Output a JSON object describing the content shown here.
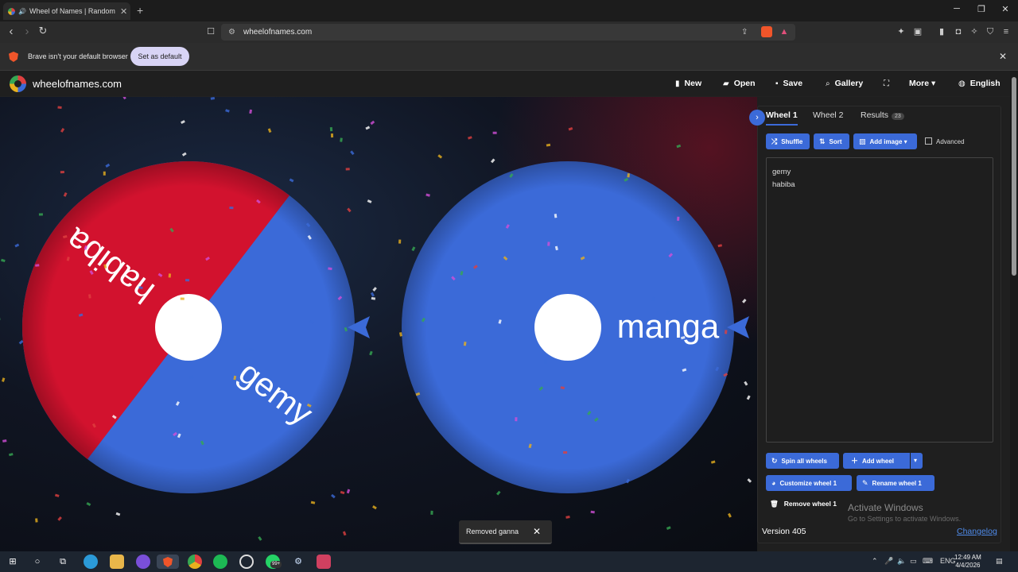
{
  "browser": {
    "tab_title": "Wheel of Names | Random na",
    "url": "wheelofnames.com",
    "infobar_message": "Brave isn't your default browser",
    "infobar_button": "Set as default"
  },
  "site": {
    "brand": "wheelofnames.com",
    "nav": {
      "new": "New",
      "open": "Open",
      "save": "Save",
      "gallery": "Gallery",
      "more": "More",
      "language": "English"
    }
  },
  "wheels": [
    {
      "segments": [
        {
          "label": "habiba",
          "color": "#d2122e"
        },
        {
          "label": "gemy",
          "color": "#3b6ad8"
        }
      ]
    },
    {
      "segments": [
        {
          "label": "manga",
          "color": "#3b6ad8"
        }
      ]
    }
  ],
  "toast": {
    "message": "Removed ganna",
    "close": "✕"
  },
  "panel": {
    "tabs": {
      "wheel1": "Wheel 1",
      "wheel2": "Wheel 2",
      "results": "Results",
      "results_count": "23"
    },
    "buttons": {
      "shuffle": "Shuffle",
      "sort": "Sort",
      "add_image": "Add image",
      "advanced": "Advanced",
      "spin_all": "Spin all wheels",
      "add_wheel": "Add wheel",
      "customize": "Customize wheel 1",
      "rename": "Rename wheel 1",
      "remove": "Remove wheel 1"
    },
    "entries": [
      "gemy",
      "habiba"
    ],
    "version": "Version 405",
    "changelog": "Changelog"
  },
  "windows_watermark": {
    "title": "Activate Windows",
    "subtitle": "Go to Settings to activate Windows."
  },
  "taskbar": {
    "lang": "ENG",
    "time": "12:49 AM",
    "date": "4/4/2026",
    "badge": "99+"
  },
  "colors": {
    "accent": "#3b6ad8",
    "red_segment": "#d2122e"
  }
}
